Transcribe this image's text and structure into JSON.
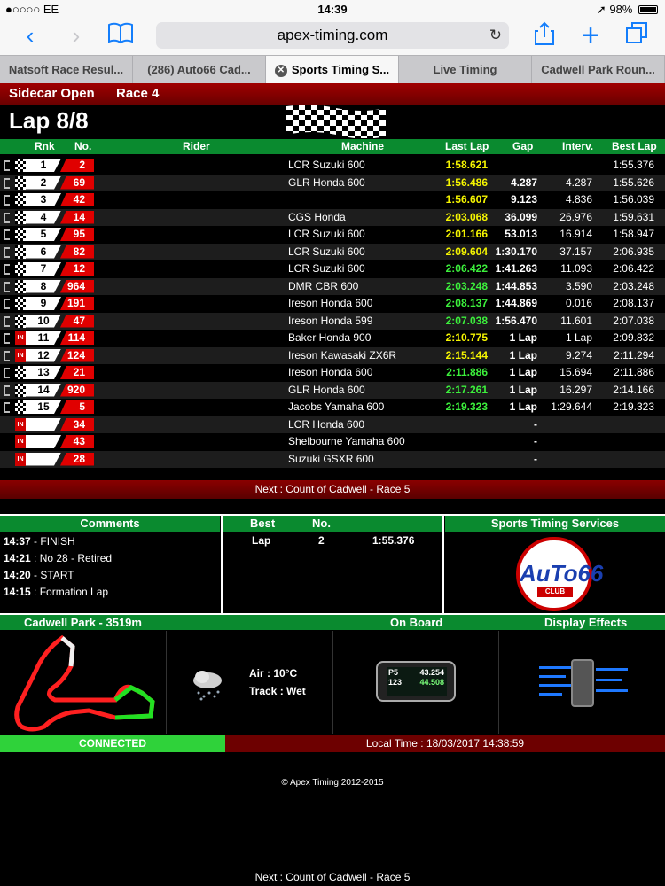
{
  "status_bar": {
    "carrier": "●○○○○ EE",
    "time": "14:39",
    "battery": "98%"
  },
  "browser": {
    "url": "apex-timing.com",
    "tabs": [
      {
        "label": "Natsoft Race Resul..."
      },
      {
        "label": "(286) Auto66 Cad..."
      },
      {
        "label": "Sports Timing S..."
      },
      {
        "label": "Live Timing"
      },
      {
        "label": "Cadwell Park Roun..."
      }
    ]
  },
  "race": {
    "category": "Sidecar Open",
    "race_name": "Race 4",
    "lap": "Lap 8/8"
  },
  "table": {
    "headers": {
      "rnk": "Rnk",
      "no": "No.",
      "rider": "Rider",
      "machine": "Machine",
      "last_lap": "Last Lap",
      "gap": "Gap",
      "interv": "Interv.",
      "best_lap": "Best Lap"
    },
    "rows": [
      {
        "rnk": "1",
        "no": "2",
        "machine": "LCR Suzuki 600",
        "last": "1:58.621",
        "last_color": "yellow",
        "gap": "",
        "interv": "",
        "best": "1:55.376",
        "status": "flag"
      },
      {
        "rnk": "2",
        "no": "69",
        "machine": "GLR Honda 600",
        "last": "1:56.486",
        "last_color": "yellow",
        "gap": "4.287",
        "interv": "4.287",
        "best": "1:55.626",
        "status": "flag"
      },
      {
        "rnk": "3",
        "no": "42",
        "machine": "",
        "last": "1:56.607",
        "last_color": "yellow",
        "gap": "9.123",
        "interv": "4.836",
        "best": "1:56.039",
        "status": "flag"
      },
      {
        "rnk": "4",
        "no": "14",
        "machine": "CGS Honda",
        "last": "2:03.068",
        "last_color": "yellow",
        "gap": "36.099",
        "interv": "26.976",
        "best": "1:59.631",
        "status": "flag"
      },
      {
        "rnk": "5",
        "no": "95",
        "machine": "LCR Suzuki 600",
        "last": "2:01.166",
        "last_color": "yellow",
        "gap": "53.013",
        "interv": "16.914",
        "best": "1:58.947",
        "status": "flag"
      },
      {
        "rnk": "6",
        "no": "82",
        "machine": "LCR Suzuki 600",
        "last": "2:09.604",
        "last_color": "yellow",
        "gap": "1:30.170",
        "interv": "37.157",
        "best": "2:06.935",
        "status": "flag"
      },
      {
        "rnk": "7",
        "no": "12",
        "machine": "LCR Suzuki 600",
        "last": "2:06.422",
        "last_color": "green",
        "gap": "1:41.263",
        "interv": "11.093",
        "best": "2:06.422",
        "status": "flag"
      },
      {
        "rnk": "8",
        "no": "964",
        "machine": "DMR CBR 600",
        "last": "2:03.248",
        "last_color": "green",
        "gap": "1:44.853",
        "interv": "3.590",
        "best": "2:03.248",
        "status": "flag"
      },
      {
        "rnk": "9",
        "no": "191",
        "machine": "Ireson Honda 600",
        "last": "2:08.137",
        "last_color": "green",
        "gap": "1:44.869",
        "interv": "0.016",
        "best": "2:08.137",
        "status": "flag"
      },
      {
        "rnk": "10",
        "no": "47",
        "machine": "Ireson Honda 599",
        "last": "2:07.038",
        "last_color": "green",
        "gap": "1:56.470",
        "interv": "11.601",
        "best": "2:07.038",
        "status": "flag"
      },
      {
        "rnk": "11",
        "no": "114",
        "machine": "Baker Honda 900",
        "last": "2:10.775",
        "last_color": "yellow",
        "gap": "1 Lap",
        "interv": "1 Lap",
        "best": "2:09.832",
        "status": "in"
      },
      {
        "rnk": "12",
        "no": "124",
        "machine": "Ireson Kawasaki ZX6R",
        "last": "2:15.144",
        "last_color": "yellow",
        "gap": "1 Lap",
        "interv": "9.274",
        "best": "2:11.294",
        "status": "in"
      },
      {
        "rnk": "13",
        "no": "21",
        "machine": "Ireson Honda 600",
        "last": "2:11.886",
        "last_color": "green",
        "gap": "1 Lap",
        "interv": "15.694",
        "best": "2:11.886",
        "status": "flag"
      },
      {
        "rnk": "14",
        "no": "920",
        "machine": "GLR Honda 600",
        "last": "2:17.261",
        "last_color": "green",
        "gap": "1 Lap",
        "interv": "16.297",
        "best": "2:14.166",
        "status": "flag"
      },
      {
        "rnk": "15",
        "no": "5",
        "machine": "Jacobs Yamaha 600",
        "last": "2:19.323",
        "last_color": "green",
        "gap": "1 Lap",
        "interv": "1:29.644",
        "best": "2:19.323",
        "status": "flag"
      },
      {
        "rnk": "",
        "no": "34",
        "machine": "LCR Honda 600",
        "last": "",
        "last_color": "yellow",
        "gap": "-",
        "interv": "",
        "best": "",
        "status": "in"
      },
      {
        "rnk": "",
        "no": "43",
        "machine": "Shelbourne Yamaha 600",
        "last": "",
        "last_color": "yellow",
        "gap": "-",
        "interv": "",
        "best": "",
        "status": "in"
      },
      {
        "rnk": "",
        "no": "28",
        "machine": "Suzuki GSXR 600",
        "last": "",
        "last_color": "yellow",
        "gap": "-",
        "interv": "",
        "best": "",
        "status": "in"
      }
    ]
  },
  "status_badge_in": "IN",
  "next_race": "Next : Count of Cadwell - Race 5",
  "comments": {
    "title": "Comments",
    "items": [
      {
        "time": "14:37",
        "text": " - FINISH"
      },
      {
        "time": "14:21",
        "text": " : No 28 - Retired"
      },
      {
        "time": "14:20",
        "text": " - START"
      },
      {
        "time": "14:15",
        "text": " : Formation Lap"
      }
    ]
  },
  "best": {
    "title": "Best",
    "no_title": "No.",
    "label": "Lap",
    "no": "2",
    "time": "1:55.376"
  },
  "sponsor": {
    "title": "Sports Timing Services",
    "logo_text": "AuTo66",
    "logo_sub": "CLUB"
  },
  "track": {
    "title": "Cadwell Park - 3519m"
  },
  "weather": {
    "air": "Air : 10°C",
    "track": "Track : Wet"
  },
  "onboard": {
    "title": "On Board",
    "pos": "P5",
    "gap": "43.254",
    "num": "123",
    "time": "44.508"
  },
  "display_effects": {
    "title": "Display Effects"
  },
  "connection": {
    "status": "CONNECTED",
    "local_time": "Local Time : 18/03/2017 14:38:59"
  },
  "copyright": "© Apex Timing 2012-2015",
  "colors": {
    "yellow": "#f5f500",
    "green": "#3cf03c",
    "red": "#e00000",
    "header_green": "#0a8a2f"
  }
}
